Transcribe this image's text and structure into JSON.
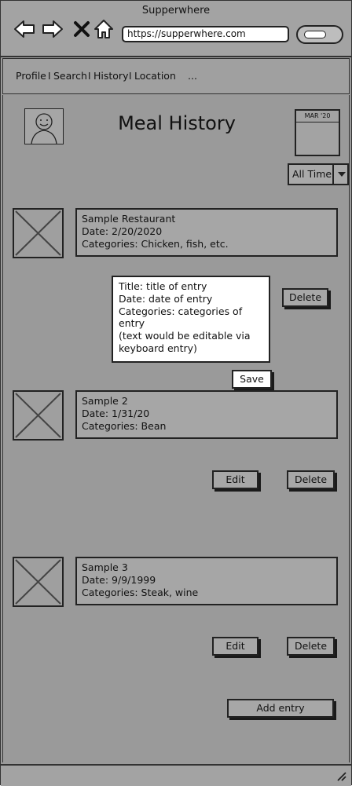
{
  "browser": {
    "title": "Supperwhere",
    "url": "https://supperwhere.com"
  },
  "nav": {
    "links": [
      "Profile",
      "Search",
      "History",
      "Location"
    ],
    "separator": "I",
    "more": "..."
  },
  "page": {
    "title": "Meal History",
    "calendar_month": "MAR '20",
    "filter": "All Time"
  },
  "entries": [
    {
      "name": "Sample Restaurant",
      "date": "Date: 2/20/2020",
      "categories": "Categories: Chicken, fish, etc."
    },
    {
      "name": "Sample 2",
      "date": "Date: 1/31/20",
      "categories": "Categories: Bean"
    },
    {
      "name": "Sample 3",
      "date": "Date: 9/9/1999",
      "categories": "Categories: Steak, wine"
    }
  ],
  "edit_panel": {
    "line1": "Title: title of entry",
    "line2": "Date: date of entry",
    "line3": "Categories: categories of entry",
    "note1": "(text would be editable via",
    "note2": "keyboard entry)"
  },
  "buttons": {
    "delete": "Delete",
    "save": "Save",
    "edit": "Edit",
    "add_entry": "Add entry"
  }
}
